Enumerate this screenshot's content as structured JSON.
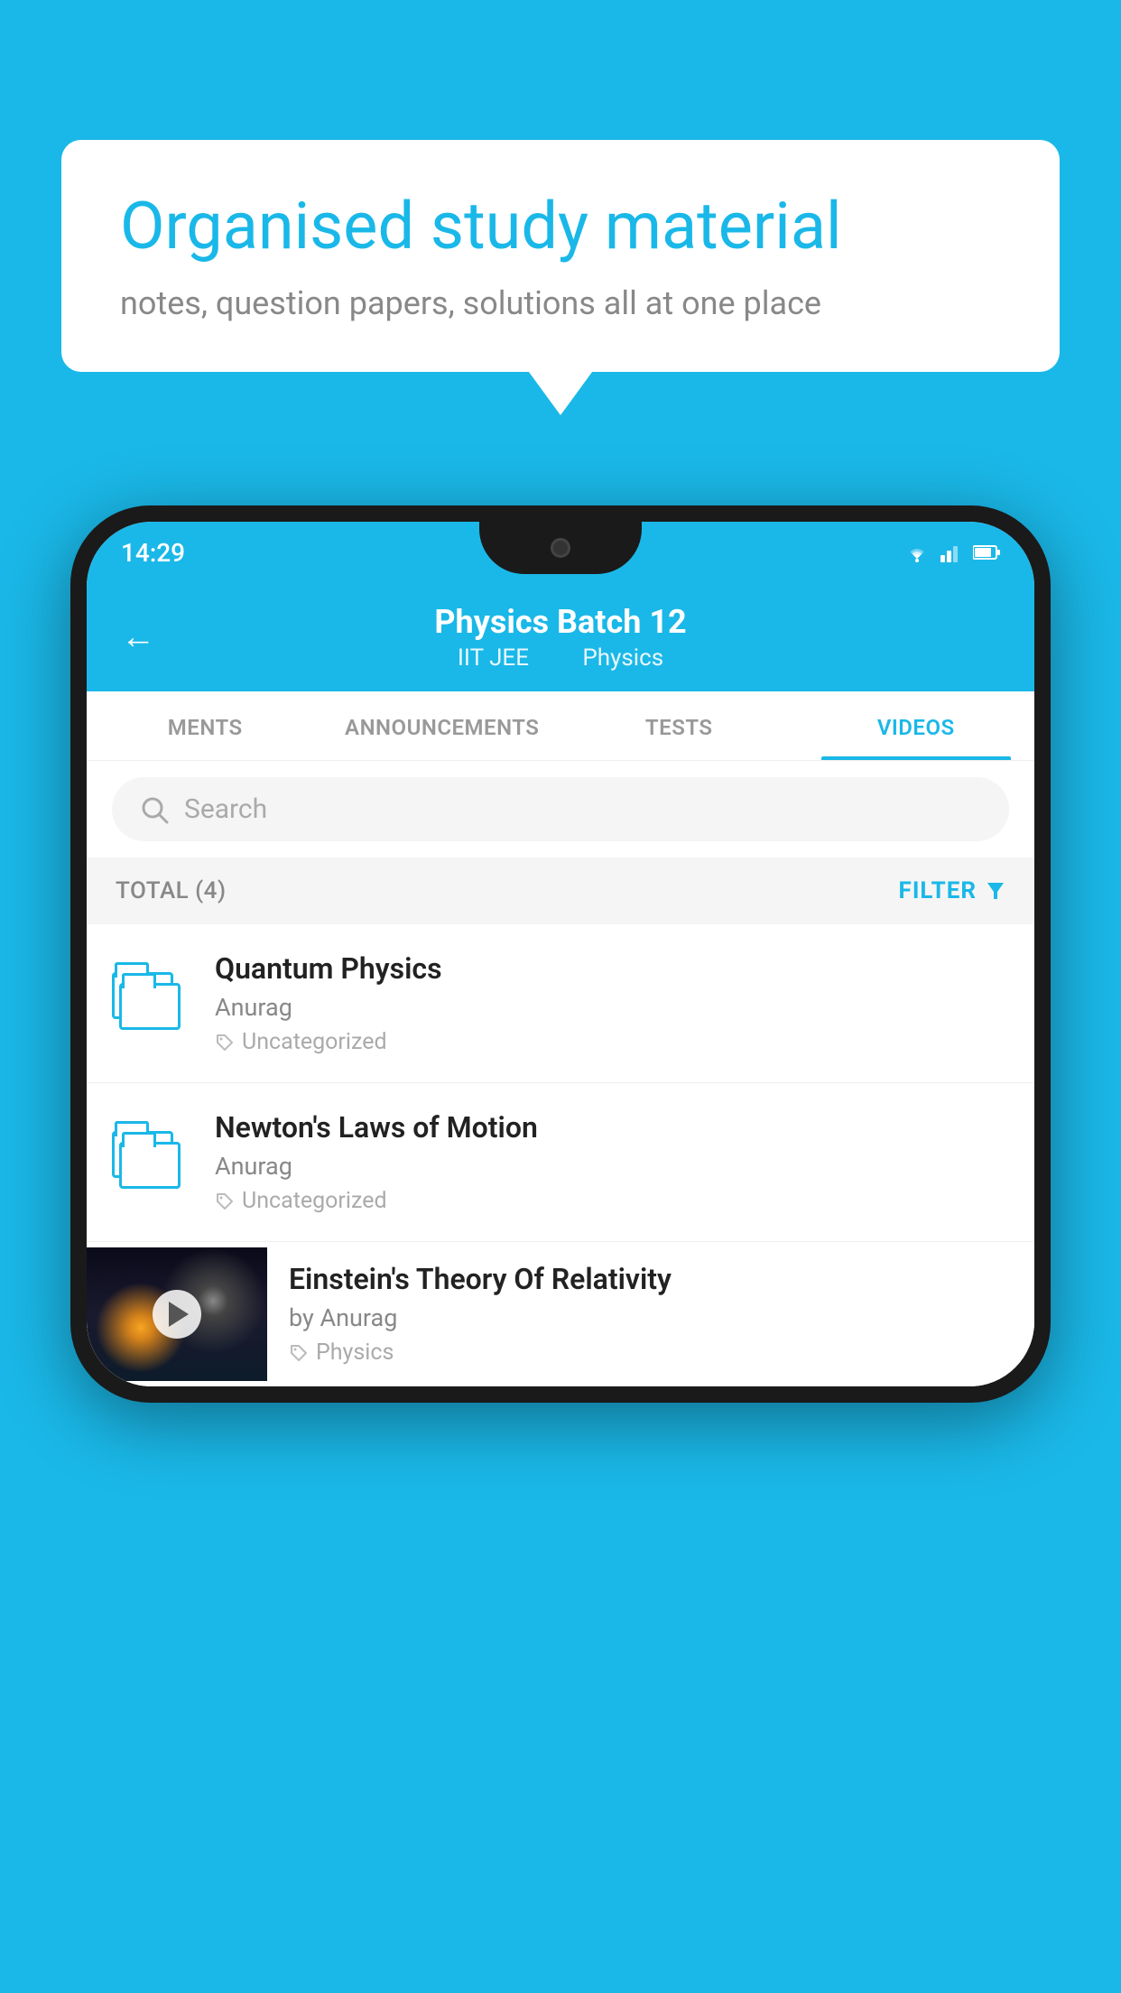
{
  "background_color": "#1ab8e8",
  "speech_bubble": {
    "title": "Organised study material",
    "subtitle": "notes, question papers, solutions all at one place"
  },
  "phone": {
    "status_bar": {
      "time": "14:29",
      "icons": [
        "wifi",
        "signal",
        "battery"
      ]
    },
    "header": {
      "back_label": "←",
      "title": "Physics Batch 12",
      "subtitle_part1": "IIT JEE",
      "subtitle_part2": "Physics"
    },
    "tabs": [
      {
        "label": "MENTS",
        "active": false
      },
      {
        "label": "ANNOUNCEMENTS",
        "active": false
      },
      {
        "label": "TESTS",
        "active": false
      },
      {
        "label": "VIDEOS",
        "active": true
      }
    ],
    "search": {
      "placeholder": "Search"
    },
    "filter_bar": {
      "total_label": "TOTAL (4)",
      "filter_label": "FILTER"
    },
    "video_items": [
      {
        "type": "folder",
        "title": "Quantum Physics",
        "author": "Anurag",
        "tag": "Uncategorized"
      },
      {
        "type": "folder",
        "title": "Newton's Laws of Motion",
        "author": "Anurag",
        "tag": "Uncategorized"
      },
      {
        "type": "thumbnail",
        "title": "Einstein's Theory Of Relativity",
        "author": "by Anurag",
        "tag": "Physics"
      }
    ]
  }
}
